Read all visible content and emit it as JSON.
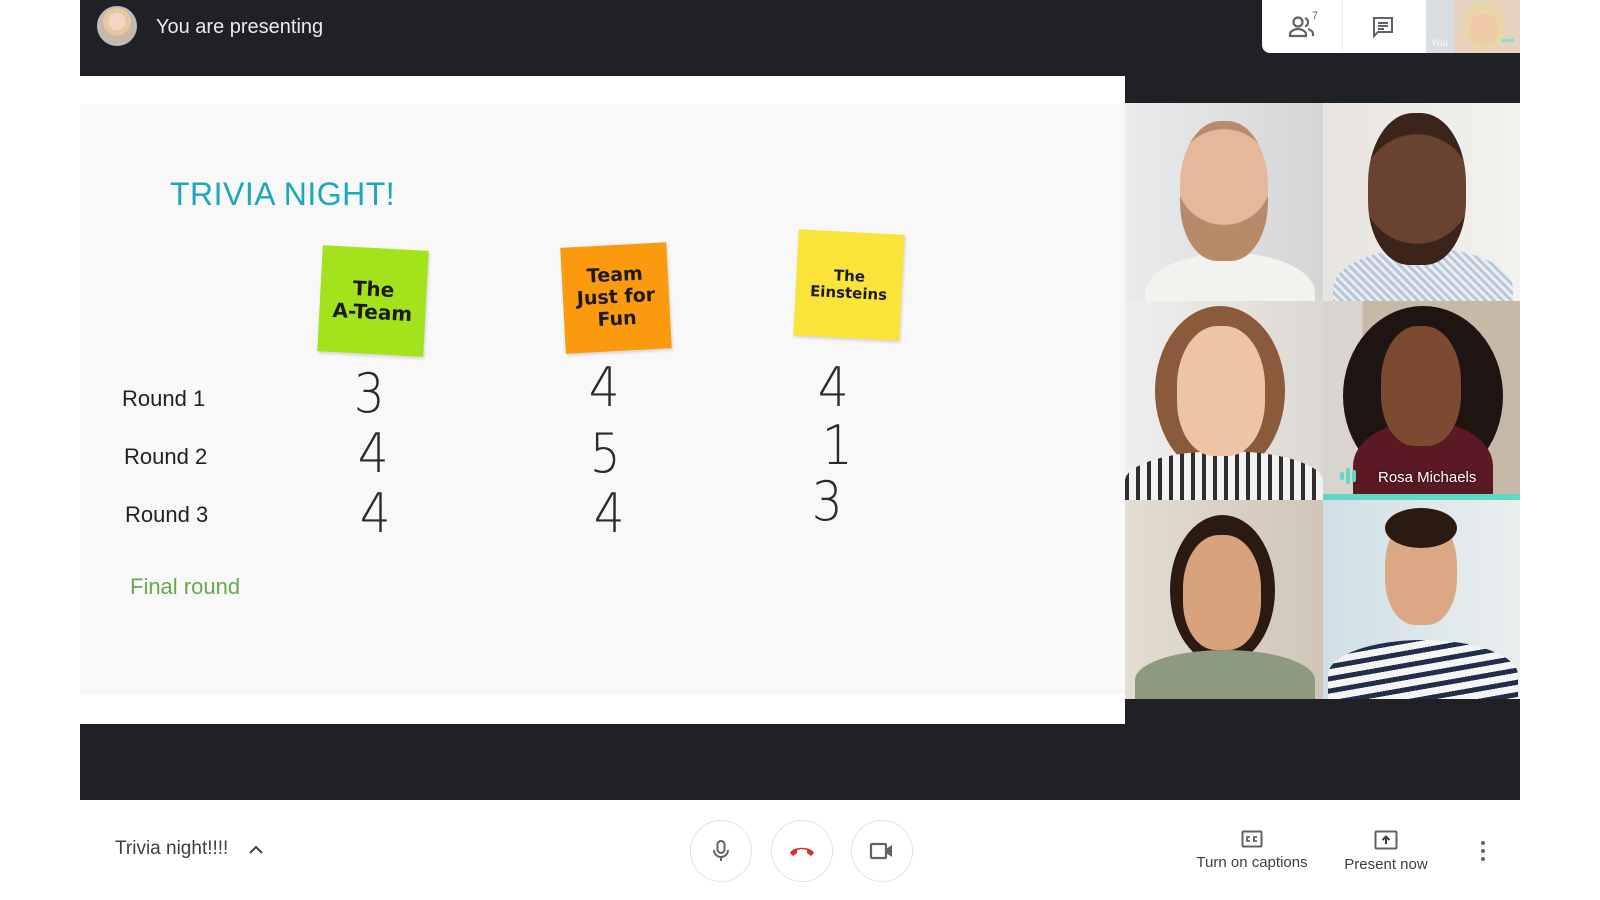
{
  "topbar": {
    "presenting_text": "You are presenting",
    "participant_count": "7",
    "self_label": "You",
    "icons": [
      "people-icon",
      "chat-icon"
    ]
  },
  "slide": {
    "title": "TRIVIA NIGHT!",
    "teams": [
      {
        "name": "The A-Team",
        "lines": [
          "The",
          "A-Team"
        ],
        "color": "#a4e21c"
      },
      {
        "name": "Team Just for Fun",
        "lines": [
          "Team",
          "Just for",
          "Fun"
        ],
        "color": "#fb9a0e"
      },
      {
        "name": "The Einsteins",
        "lines": [
          "The",
          "Einsteins"
        ],
        "color": "#fbe43a"
      }
    ],
    "rounds": [
      {
        "label": "Round 1",
        "scores": [
          "3",
          "4",
          "4"
        ]
      },
      {
        "label": "Round 2",
        "scores": [
          "4",
          "5",
          "1"
        ]
      },
      {
        "label": "Round 3",
        "scores": [
          "4",
          "4",
          "3"
        ]
      }
    ],
    "final_label": "Final round",
    "title_color": "#1ba8ba",
    "final_color": "#6aa84f"
  },
  "participants": [
    {
      "name": ""
    },
    {
      "name": ""
    },
    {
      "name": ""
    },
    {
      "name": "Rosa Michaels",
      "speaking": true
    },
    {
      "name": ""
    },
    {
      "name": ""
    }
  ],
  "bottombar": {
    "meeting_name": "Trivia night!!!!",
    "captions_label": "Turn on captions",
    "present_label": "Present now",
    "hangup_color": "#d93025",
    "speaking_color": "#5fd9c3"
  }
}
